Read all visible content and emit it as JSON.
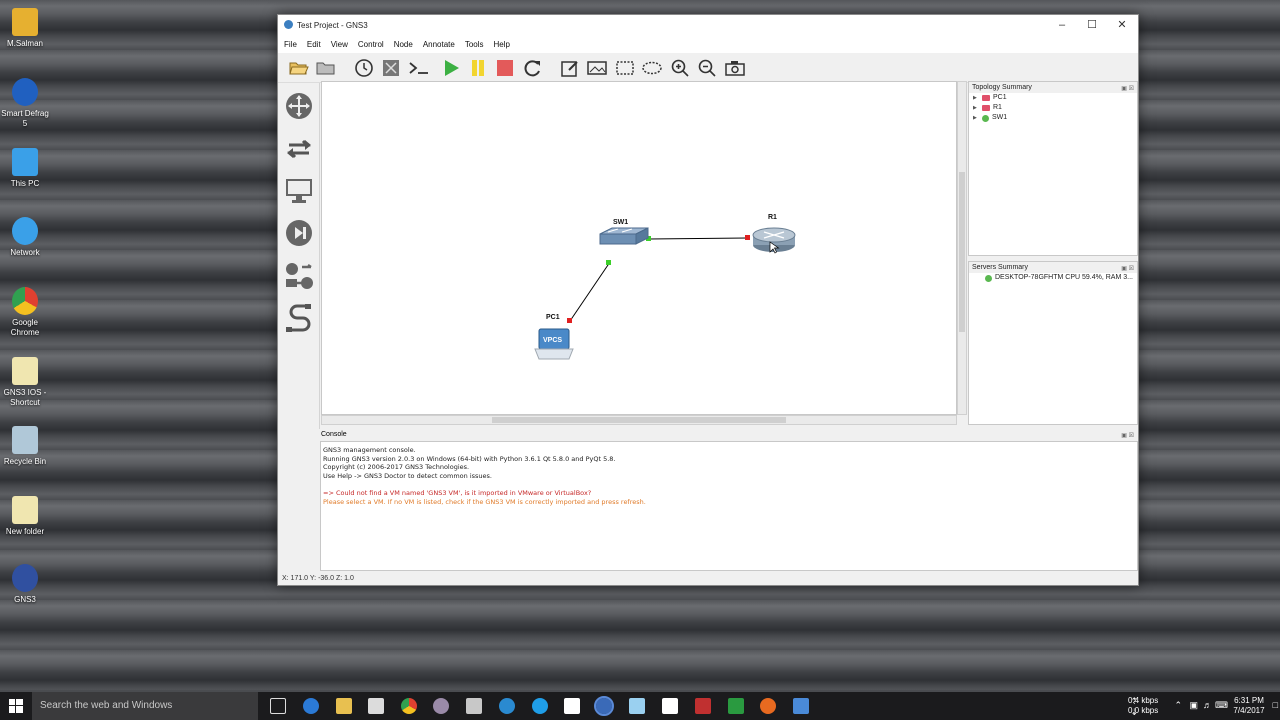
{
  "desktop": {
    "icons": [
      {
        "label": "M.Salman",
        "color": "#e6b030"
      },
      {
        "label": "Smart Defrag 5",
        "color": "#2060c0"
      },
      {
        "label": "This PC",
        "color": "#3aa0e8"
      },
      {
        "label": "Network",
        "color": "#3aa0e8"
      },
      {
        "label": "Google Chrome",
        "color": "#e04030"
      },
      {
        "label": "GNS3 IOS - Shortcut",
        "color": "#f0e6b0"
      },
      {
        "label": "Recycle Bin",
        "color": "#b0c8d8"
      },
      {
        "label": "New folder",
        "color": "#f0e6b0"
      },
      {
        "label": "GNS3",
        "color": "#3050a0"
      }
    ]
  },
  "window": {
    "title": "Test Project - GNS3",
    "menu": [
      "File",
      "Edit",
      "View",
      "Control",
      "Node",
      "Annotate",
      "Tools",
      "Help"
    ]
  },
  "topology": {
    "nodes": {
      "sw1": "SW1",
      "r1": "R1",
      "pc1": "PC1",
      "pc1_badge": "VPCS"
    }
  },
  "topology_summary": {
    "title": "Topology Summary",
    "items": [
      {
        "label": "PC1",
        "status": "red"
      },
      {
        "label": "R1",
        "status": "red"
      },
      {
        "label": "SW1",
        "status": "green"
      }
    ]
  },
  "servers_summary": {
    "title": "Servers Summary",
    "items": [
      {
        "label": "DESKTOP-78GFHTM CPU 59.4%, RAM 3..."
      }
    ]
  },
  "console": {
    "title": "Console",
    "lines": [
      "GNS3 management console.",
      "Running GNS3 version 2.0.3 on Windows (64-bit) with Python 3.6.1 Qt 5.8.0 and PyQt 5.8.",
      "Copyright (c) 2006-2017 GNS3 Technologies.",
      "Use Help -> GNS3 Doctor to detect common issues."
    ],
    "error": "=> Could not find a VM named 'GNS3 VM', is it imported in VMware or VirtualBox?",
    "warning": "Please select a VM. If no VM is listed, check if the GNS3 VM is correctly imported and press refresh."
  },
  "statusbar": {
    "coords": "X: 171.0 Y: -36.0 Z: 1.0"
  },
  "taskbar": {
    "search_placeholder": "Search the web and Windows",
    "net_up": "0.4 kbps",
    "net_down": "0.0 kbps",
    "time": "6:31 PM",
    "date": "7/4/2017"
  }
}
